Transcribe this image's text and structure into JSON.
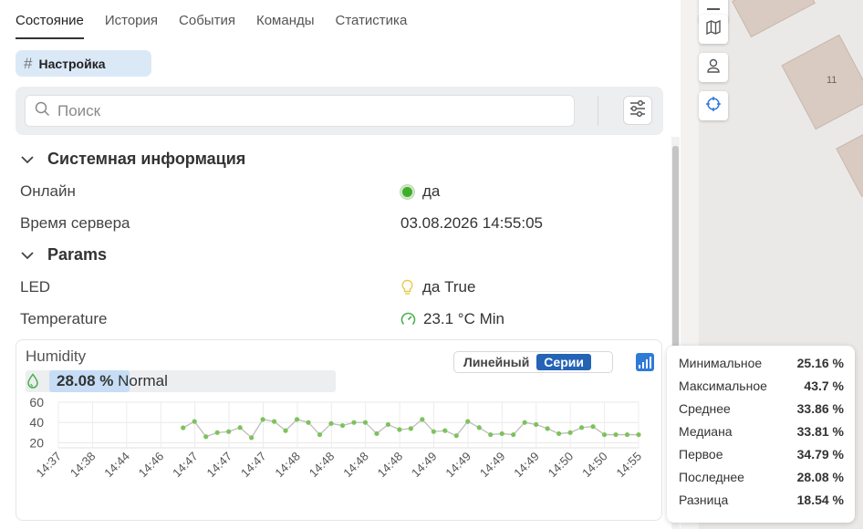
{
  "tabs": [
    {
      "label": "Состояние",
      "active": true
    },
    {
      "label": "История",
      "active": false
    },
    {
      "label": "События",
      "active": false
    },
    {
      "label": "Команды",
      "active": false
    },
    {
      "label": "Статистика",
      "active": false
    }
  ],
  "chip": {
    "label": "Настройка"
  },
  "search": {
    "placeholder": "Поиск",
    "value": ""
  },
  "sections": {
    "system": "Системная информация",
    "params": "Params"
  },
  "props": {
    "online_label": "Онлайн",
    "online_value": "да",
    "server_time_label": "Время сервера",
    "server_time_value": "03.08.2026 14:55:05",
    "led_label": "LED",
    "led_value": "да True",
    "temp_label": "Temperature",
    "temp_value": "23.1 °C Min"
  },
  "humidity": {
    "title": "Humidity",
    "value": "28.08 %",
    "status": "Normal",
    "fill_fraction": 0.28,
    "mode_line": "Линейный",
    "mode_series": "Серии"
  },
  "chart_data": {
    "type": "line",
    "ylim": [
      15,
      60
    ],
    "yticks": [
      "60",
      "40",
      "20"
    ],
    "categories": [
      "14:37",
      "14:38",
      "14:44",
      "14:46",
      "14:47",
      "14:47",
      "14:47",
      "14:48",
      "14:48",
      "14:48",
      "14:48",
      "14:49",
      "14:49",
      "14:49",
      "14:49",
      "14:50",
      "14:50",
      "14:55"
    ],
    "x_start_fraction": 0.215,
    "values": [
      34.8,
      41,
      26,
      30,
      31,
      35,
      25,
      43,
      41,
      32,
      43,
      40,
      28,
      39,
      37,
      40,
      40,
      29,
      38,
      33,
      34,
      43,
      31,
      32,
      27,
      41,
      35,
      28,
      29,
      28,
      40,
      38,
      34,
      29,
      30,
      35,
      36,
      28,
      28,
      28,
      28
    ]
  },
  "stats": [
    {
      "label": "Минимальное",
      "value": "25.16 %"
    },
    {
      "label": "Максимальное",
      "value": "43.7 %"
    },
    {
      "label": "Среднее",
      "value": "33.86 %"
    },
    {
      "label": "Медиана",
      "value": "33.81 %"
    },
    {
      "label": "Первое",
      "value": "34.79 %"
    },
    {
      "label": "Последнее",
      "value": "28.08 %"
    },
    {
      "label": "Разница",
      "value": "18.54 %"
    }
  ],
  "map": {
    "building_label": "11"
  },
  "colors": {
    "accent": "#2463b6",
    "online": "#3fae2a",
    "series": "#7cc35a"
  }
}
